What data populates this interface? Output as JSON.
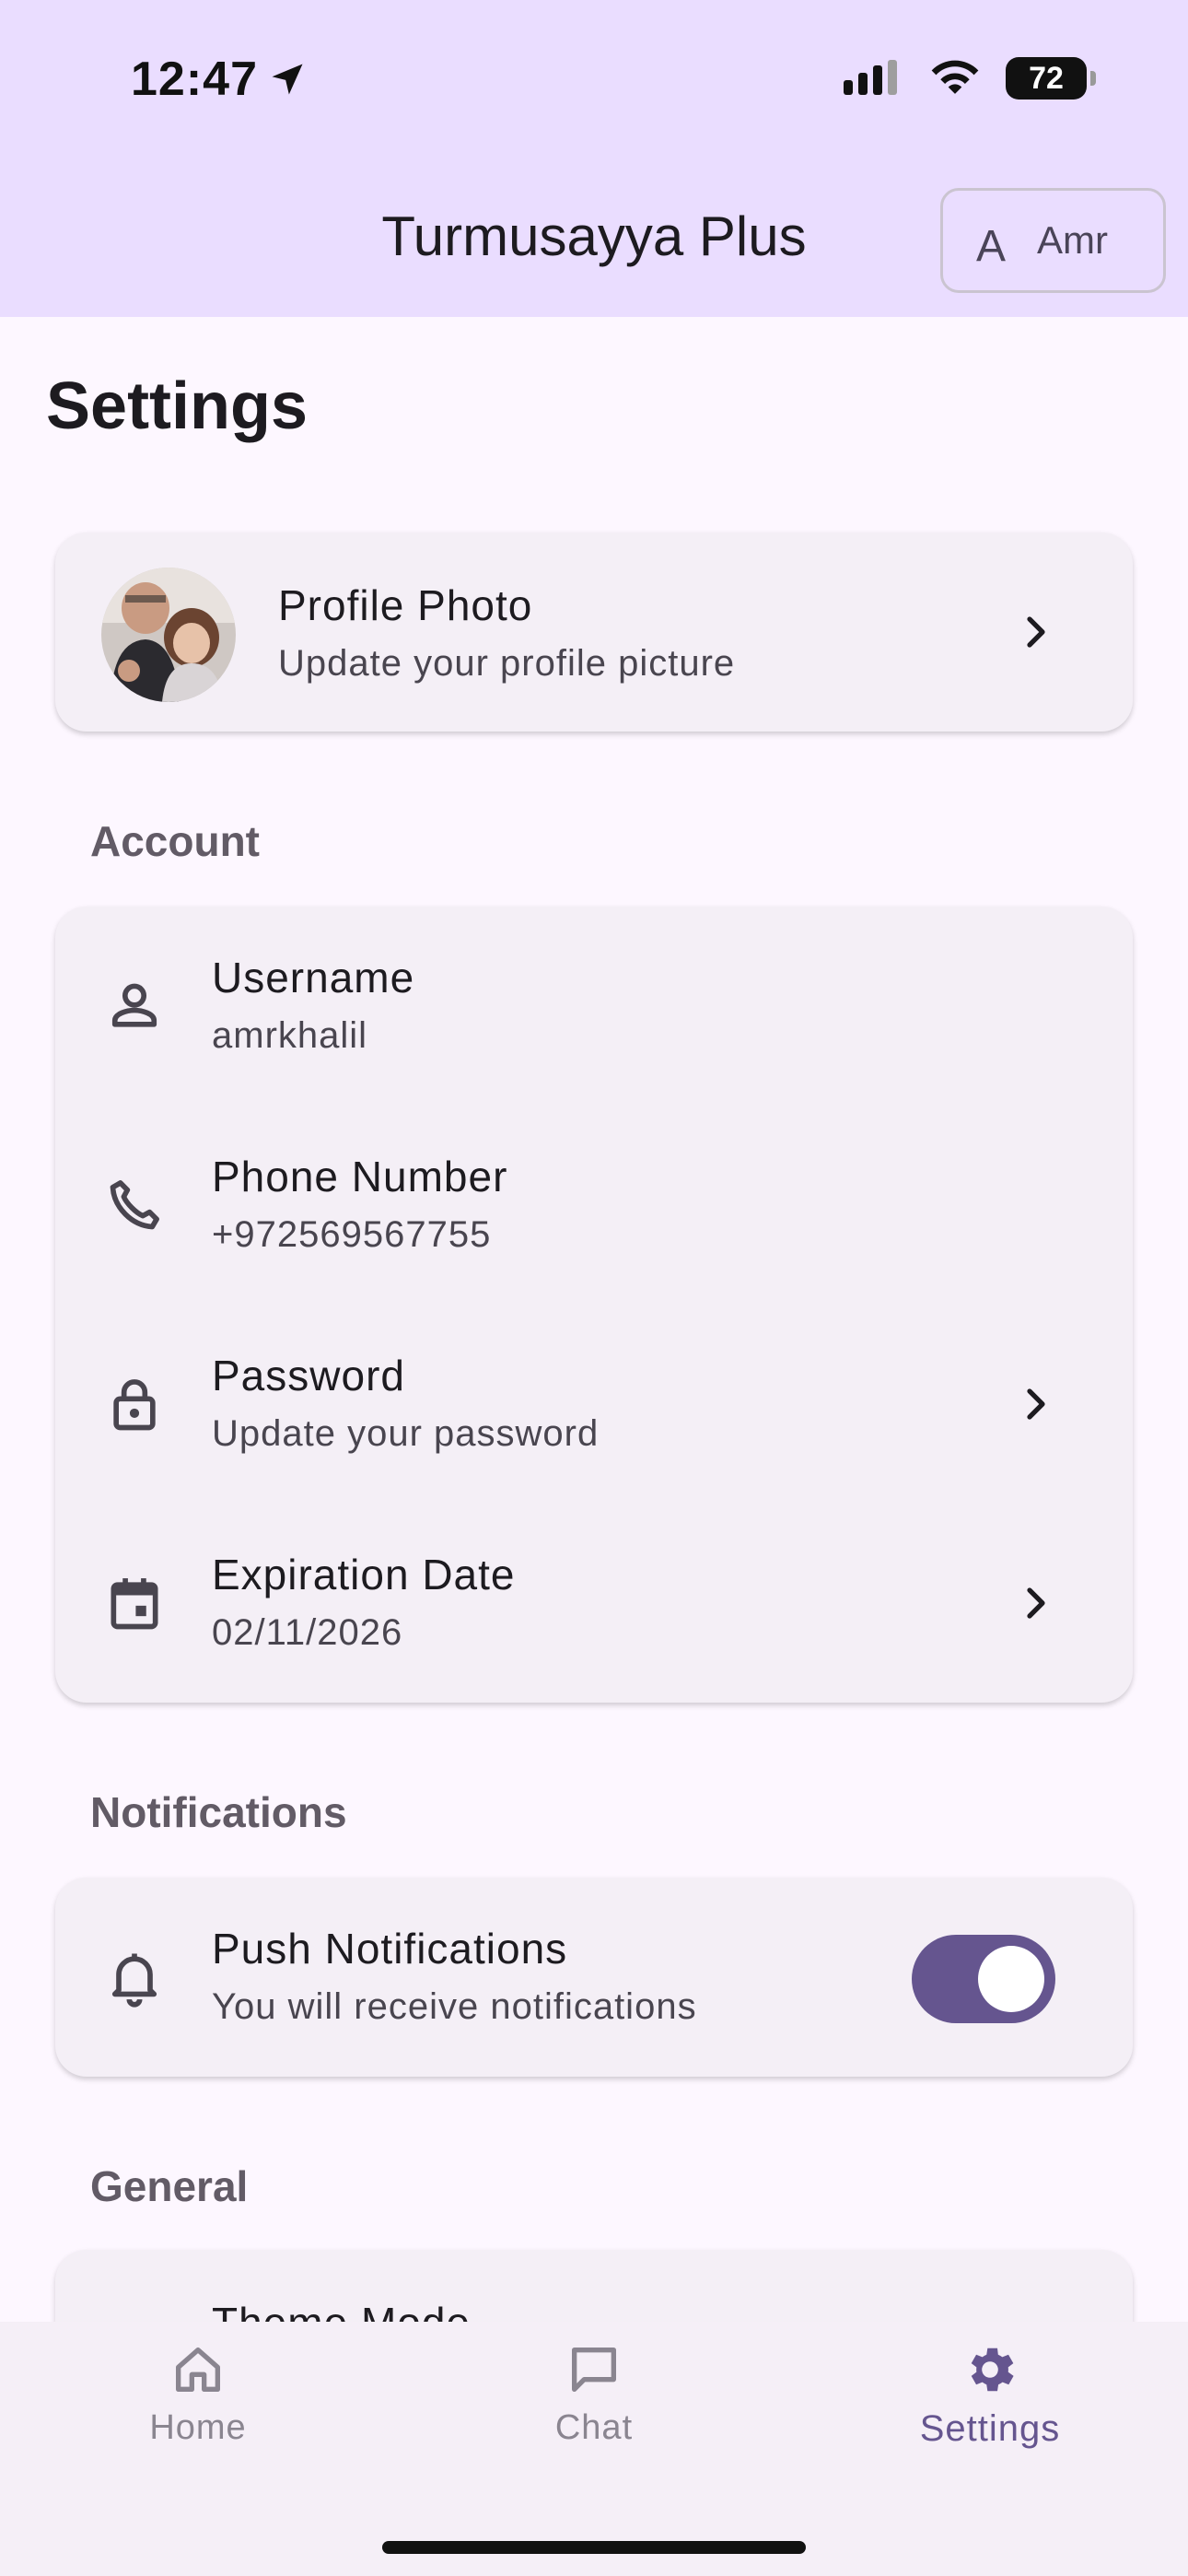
{
  "status_bar": {
    "time": "12:47",
    "battery": "72"
  },
  "app_bar": {
    "title": "Turmusayya Plus",
    "user_initial": "A",
    "user_name": "Amr"
  },
  "page": {
    "title": "Settings"
  },
  "profile": {
    "title": "Profile Photo",
    "subtitle": "Update your profile picture"
  },
  "account": {
    "label": "Account",
    "items": [
      {
        "title": "Username",
        "subtitle": "amrkhalil",
        "icon": "person-icon"
      },
      {
        "title": "Phone Number",
        "subtitle": "+972569567755",
        "icon": "phone-icon"
      },
      {
        "title": "Password",
        "subtitle": "Update your password",
        "icon": "lock-icon"
      },
      {
        "title": "Expiration Date",
        "subtitle": "02/11/2026",
        "icon": "calendar-icon"
      }
    ]
  },
  "notifications": {
    "label": "Notifications",
    "push": {
      "title": "Push Notifications",
      "subtitle": "You will receive notifications",
      "enabled": true
    }
  },
  "general": {
    "label": "General",
    "partial_item": "Theme Mode"
  },
  "bottom_nav": {
    "items": [
      {
        "label": "Home",
        "icon": "home-icon"
      },
      {
        "label": "Chat",
        "icon": "chat-icon"
      },
      {
        "label": "Settings",
        "icon": "gear-icon"
      }
    ],
    "active": "Settings"
  },
  "colors": {
    "app_bar_bg": "#eaddff",
    "page_bg": "#fdf7ff",
    "card_bg": "#f4eff6",
    "accent": "#65558f",
    "nav_bg": "#f5eff7"
  }
}
